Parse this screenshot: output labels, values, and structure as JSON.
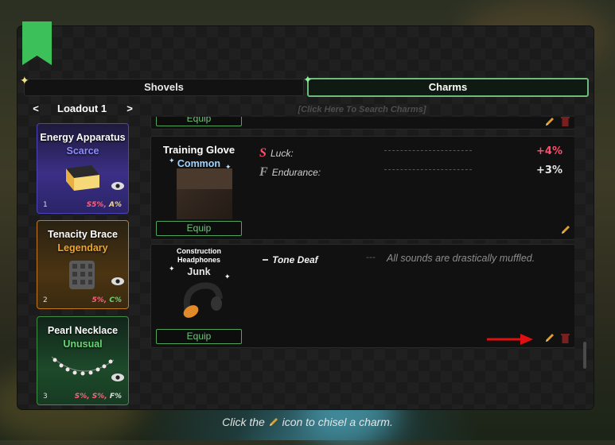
{
  "tabs": [
    {
      "label": "Shovels",
      "active": false
    },
    {
      "label": "Charms",
      "active": true
    }
  ],
  "loadout": {
    "title": "Loadout 1",
    "prev": "<",
    "next": ">"
  },
  "search": {
    "placeholder": "[Click Here To Search Charms]"
  },
  "slots": [
    {
      "name": "Energy Apparatus",
      "rarity": "Scarce",
      "rarity_color": "#8e8cff",
      "number": "1",
      "stats": "S5%, A%",
      "border": "#4d44b8"
    },
    {
      "name": "Tenacity Brace",
      "rarity": "Legendary",
      "rarity_color": "#f0a52c",
      "number": "2",
      "stats": "5%, C%",
      "border": "#c47a1c"
    },
    {
      "name": "Pearl Necklace",
      "rarity": "Unusual",
      "rarity_color": "#6cd476",
      "number": "3",
      "stats": "S%, S%, F%",
      "border": "#3f8f47"
    }
  ],
  "cards": [
    {
      "equip_label": "Equip"
    },
    {
      "name": "Training Glove",
      "rarity": "Common",
      "equip_label": "Equip",
      "stats": [
        {
          "letter": "S",
          "label": "Luck:",
          "value": "+4%",
          "color": "#ff4d6a"
        },
        {
          "letter": "F",
          "label": "Endurance:",
          "value": "+3%",
          "color": "#e6e6e6"
        }
      ]
    },
    {
      "name_line1": "Construction",
      "name_line2": "Headphones",
      "rarity": "Junk",
      "equip_label": "Equip",
      "trait": "Tone Deaf",
      "trait_sep": "---",
      "trait_desc": "All sounds are drastically muffled."
    }
  ],
  "footer": {
    "before": "Click the",
    "after": "icon to chisel a charm."
  },
  "colors": {
    "accent": "#6fb97a",
    "pencil": "#e0a030",
    "trash": "#7a1f1f",
    "arrow": "#e01010"
  },
  "icons": [
    "bookmark-icon",
    "sparkle-icon",
    "eye-icon",
    "pencil-icon",
    "trash-icon",
    "arrow-icon"
  ]
}
